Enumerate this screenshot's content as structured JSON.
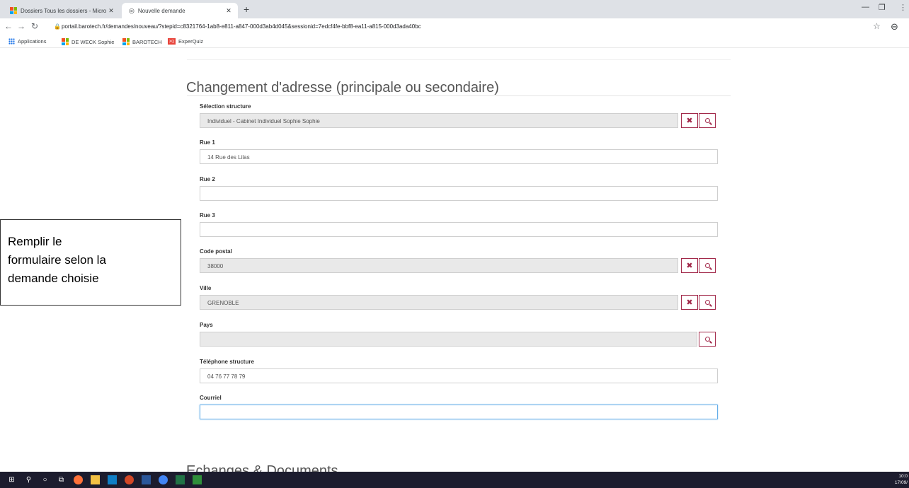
{
  "browser": {
    "tabs": [
      {
        "title": "Dossiers Tous les dossiers - Micro",
        "close": "✕"
      },
      {
        "title": "Nouvelle demande",
        "close": "✕"
      }
    ],
    "new_tab": "+",
    "url": "portail.barotech.fr/demandes/nouveau/?stepid=c8321764-1ab8-e811-a847-000d3ab4d045&sessionid=7edcf4fe-bbf8-ea11-a815-000d3ada40bc",
    "bookmarks": [
      {
        "label": "Applications",
        "icon": "apps-grid-icon"
      },
      {
        "label": "DE WECK Sophie",
        "icon": "microsoft-logo-icon"
      },
      {
        "label": "BAROTECH",
        "icon": "microsoft-logo-icon"
      },
      {
        "label": "ExperQuiz",
        "icon": "experquiz-icon",
        "icon_text": "XQ"
      }
    ]
  },
  "form": {
    "title": "Changement d'adresse (principale ou secondaire)",
    "fields": {
      "structure": {
        "label": "Sélection structure",
        "value": "Individuel - Cabinet Individuel Sophie Sophie"
      },
      "rue1": {
        "label": "Rue 1",
        "value": "14 Rue des Lilas"
      },
      "rue2": {
        "label": "Rue 2",
        "value": ""
      },
      "rue3": {
        "label": "Rue 3",
        "value": ""
      },
      "code_postal": {
        "label": "Code postal",
        "value": "38000"
      },
      "ville": {
        "label": "Ville",
        "value": "GRENOBLE"
      },
      "pays": {
        "label": "Pays",
        "value": ""
      },
      "telephone": {
        "label": "Téléphone structure",
        "value": "04 76 77 78 79"
      },
      "courriel": {
        "label": "Courriel",
        "value": ""
      }
    },
    "clear_glyph": "✖",
    "next_section_title": "Echanges & Documents"
  },
  "callout": {
    "lines": [
      "Remplir le",
      "formulaire selon la",
      "demande choisie"
    ]
  },
  "taskbar": {
    "time": "10:0",
    "date": "17/09/"
  },
  "colors": {
    "accent": "#a2294a",
    "focus": "#66afe9"
  }
}
